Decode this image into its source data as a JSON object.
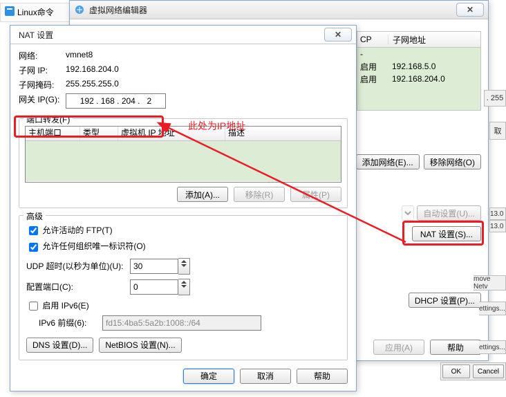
{
  "tab": {
    "label": "Linux命令"
  },
  "vnet_editor": {
    "title": "虚拟网络编辑器",
    "cols": {
      "dhcp": "CP",
      "subnet": "子网地址"
    },
    "rows": [
      {
        "state": "启用",
        "addr": "192.168.5.0"
      },
      {
        "state": "启用",
        "addr": "192.168.204.0"
      }
    ],
    "dash": "-",
    "add_net": "添加网络(E)...",
    "remove_net": "移除网络(O)",
    "auto_set": "自动设置(U)...",
    "nat_set": "NAT 设置(S)...",
    "dhcp_set": "DHCP 设置(P)...",
    "apply": "应用(A)",
    "help": "帮助"
  },
  "nat": {
    "title": "NAT 设置",
    "labels": {
      "network": "网络:",
      "subnet": "子网 IP:",
      "mask": "子网掩码:",
      "gateway": "网关 IP(G):",
      "pf": "端口转发(F)",
      "host_port": "主机端口",
      "type": "类型",
      "vm_ip": "虚拟机 IP 地址",
      "desc": "描述",
      "advanced": "高级",
      "allow_ftp": "允许活动的 FTP(T)",
      "allow_any": "允许任何组织唯一标识符(O)",
      "udp": "UDP 超时(以秒为单位)(U):",
      "cfg_port": "配置端口(C):",
      "enable_v6": "启用 IPv6(E)",
      "v6_prefix": "IPv6 前缀(6):"
    },
    "values": {
      "network": "vmnet8",
      "subnet": "192.168.204.0",
      "mask": "255.255.255.0",
      "gateway": "192 . 168 . 204 .   2",
      "udp": "30",
      "cfg_port": "0",
      "v6_prefix": "fd15:4ba5:5a2b:1008::/64"
    },
    "buttons": {
      "add": "添加(A)...",
      "remove": "移除(R)",
      "props": "属性(P)",
      "dns": "DNS 设置(D)...",
      "netbios": "NetBIOS 设置(N)...",
      "ok": "确定",
      "cancel": "取消",
      "help": "帮助"
    }
  },
  "annotation": {
    "text": "此处为IP地址"
  },
  "bg": {
    "ip_tail": ". 255",
    "cancel_frag": "取",
    "num1": "13.0",
    "num2": "13.0",
    "move_net": "move Netv",
    "settings": "ettings...",
    "settings2": "ettings...",
    "ok": "OK",
    "cancel": "Cancel"
  }
}
